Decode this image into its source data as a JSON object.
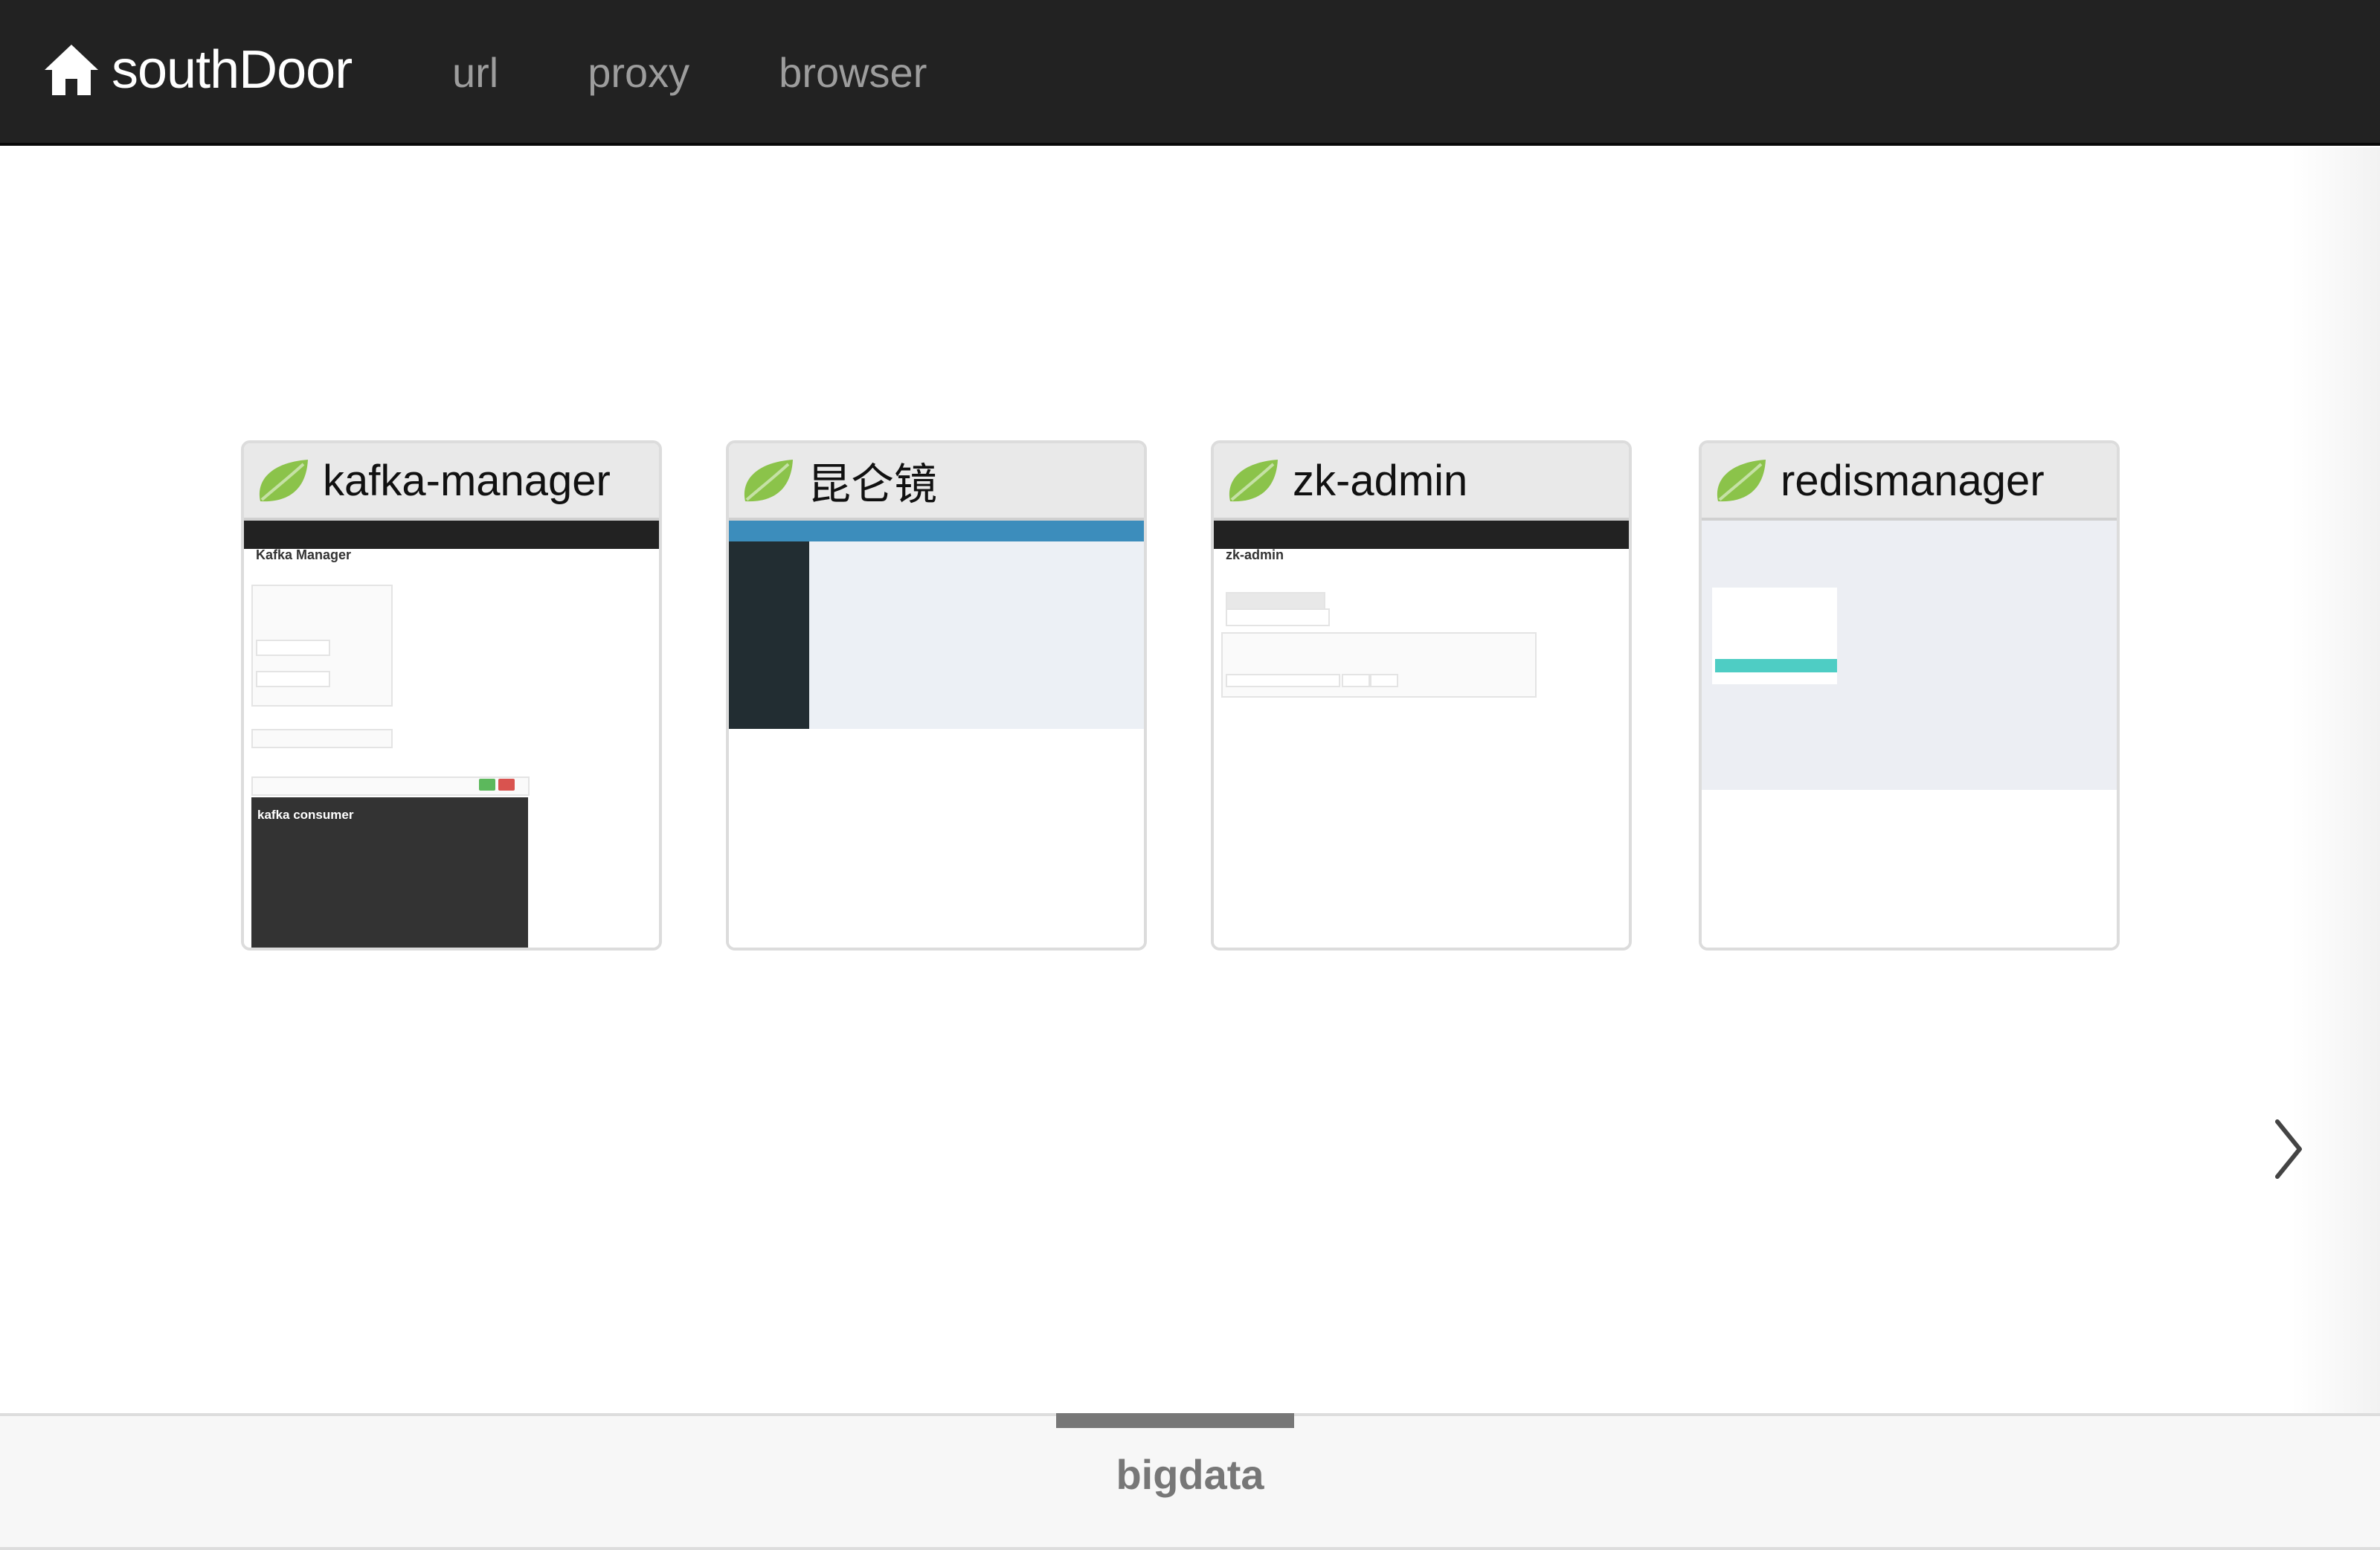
{
  "navbar": {
    "brand": "southDoor",
    "brand_icon": "home-icon",
    "links": [
      "url",
      "proxy",
      "browser"
    ]
  },
  "colors": {
    "navbar_bg": "#222222",
    "nav_link": "#9d9d9d",
    "leaf_green": "#8bc34a",
    "mini_blue": "#3c8dbc",
    "mini_teal": "#4ecdc4"
  },
  "cards": [
    {
      "title": "kafka-manager",
      "icon": "leaf-icon",
      "preview": {
        "heading": "Kafka Manager",
        "panel_label": "kafka consumer"
      }
    },
    {
      "title": "昆仑镜",
      "icon": "leaf-icon",
      "preview": {}
    },
    {
      "title": "zk-admin",
      "icon": "leaf-icon",
      "preview": {
        "heading": "zk-admin"
      }
    },
    {
      "title": "redismanager",
      "icon": "leaf-icon",
      "preview": {}
    }
  ],
  "carousel": {
    "next_icon": "chevron-right-icon"
  },
  "footer": {
    "label": "bigdata"
  }
}
